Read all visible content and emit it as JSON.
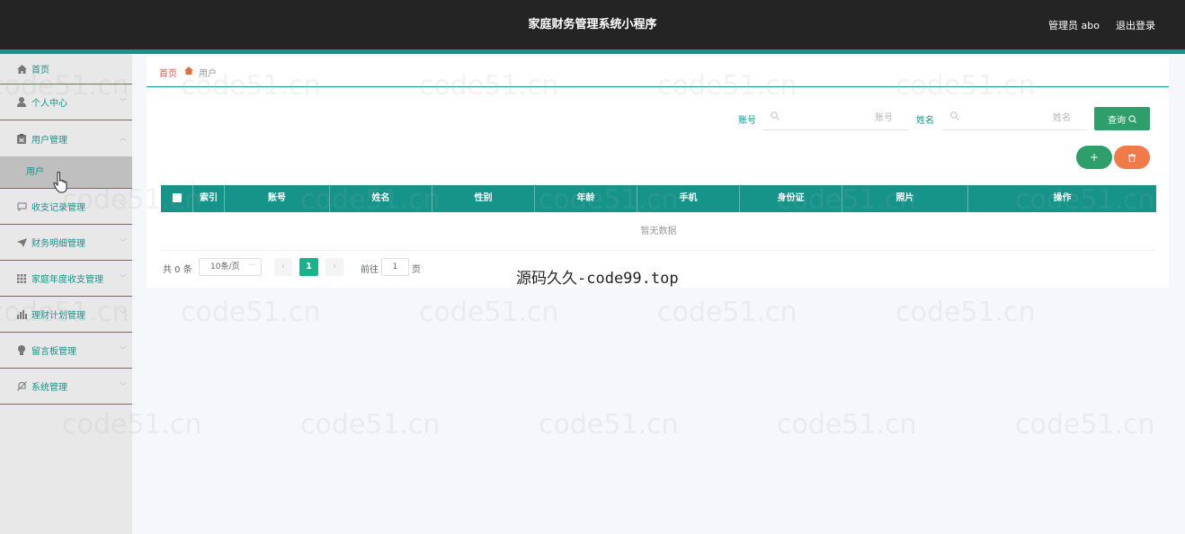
{
  "header": {
    "title": "家庭财务管理系统小程序",
    "admin_label": "管理员 abo",
    "logout_label": "退出登录"
  },
  "sidebar": {
    "items": [
      {
        "label": "首页",
        "icon": "home-icon"
      },
      {
        "label": "个人中心",
        "icon": "user-icon"
      },
      {
        "label": "用户管理",
        "icon": "clipboard-icon"
      },
      {
        "label": "收支记录管理",
        "icon": "comment-icon"
      },
      {
        "label": "财务明细管理",
        "icon": "send-icon"
      },
      {
        "label": "家庭年度收支管理",
        "icon": "grid-icon"
      },
      {
        "label": "理财计划管理",
        "icon": "bar-chart-icon"
      },
      {
        "label": "留言板管理",
        "icon": "bulb-icon"
      },
      {
        "label": "系统管理",
        "icon": "bell-off-icon"
      }
    ],
    "sub_item": "用户"
  },
  "breadcrumb": {
    "home": "首页",
    "current": "用户"
  },
  "search": {
    "account_label": "账号",
    "account_placeholder": "账号",
    "name_label": "姓名",
    "name_placeholder": "姓名",
    "query_button": "查询"
  },
  "actions": {
    "add": "+",
    "delete_icon": "trash-icon"
  },
  "table": {
    "columns": [
      "索引",
      "账号",
      "姓名",
      "性别",
      "年龄",
      "手机",
      "身份证",
      "照片",
      "操作"
    ],
    "empty_text": "暂无数据"
  },
  "pagination": {
    "total": "共 0 条",
    "page_size": "10条/页",
    "current_page": "1",
    "goto_label": "前往",
    "goto_value": "1",
    "page_suffix": "页"
  },
  "watermarks": {
    "source": "源码久久-code99.top",
    "site": "code51.cn"
  },
  "colors": {
    "header_bg": "#242424",
    "accent": "#17948a",
    "query_button": "#2e9f6a",
    "delete_button": "#f07a4a",
    "breadcrumb_home": "#d9534f"
  }
}
